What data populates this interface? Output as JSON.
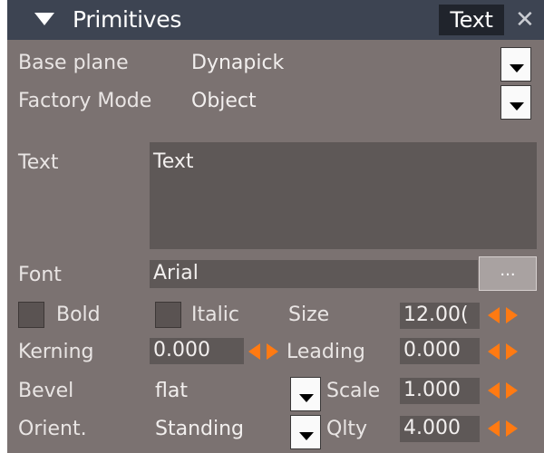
{
  "title_bar": {
    "title": "Primitives",
    "active_tab": "Text",
    "close_glyph": "✕"
  },
  "rows": {
    "base_plane": {
      "label": "Base plane",
      "value": "Dynapick"
    },
    "factory_mode": {
      "label": "Factory Mode",
      "value": "Object"
    },
    "text": {
      "label": "Text",
      "value": "Text"
    },
    "font": {
      "label": "Font",
      "value": "Arial",
      "browse_label": "..."
    },
    "bold": {
      "label": "Bold",
      "checked": false
    },
    "italic": {
      "label": "Italic",
      "checked": false
    },
    "size": {
      "label": "Size",
      "value": "12.00("
    },
    "kerning": {
      "label": "Kerning",
      "value": "0.000"
    },
    "leading": {
      "label": "Leading",
      "value": "0.000"
    },
    "bevel": {
      "label": "Bevel",
      "value": "flat"
    },
    "scale": {
      "label": "Scale",
      "value": "1.000"
    },
    "orient": {
      "label": "Orient.",
      "value": "Standing"
    },
    "qlty": {
      "label": "Qlty",
      "value": "4.000"
    }
  },
  "colors": {
    "panel_bg": "#7b7271",
    "title_bg": "#3d4452",
    "field_bg": "#5e5857",
    "accent_orange": "#ff7a12"
  },
  "icons": {
    "collapse": "triangle-down-icon",
    "close": "close-icon",
    "dropdown": "chevron-down-icon",
    "spinner": "spinner-arrows-icon"
  }
}
